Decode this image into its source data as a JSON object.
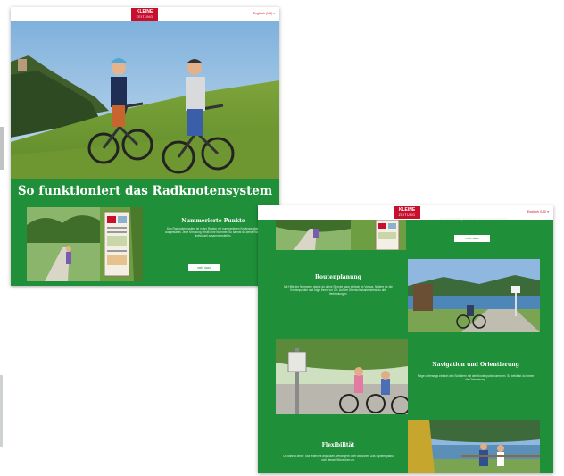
{
  "screen1": {
    "logo_line1": "KLEINE",
    "logo_line2": "ZEITUNG",
    "lang_link": "Englisch (US) ▾",
    "heading": "So funktioniert das Radknotensystem",
    "section": {
      "title": "Nummerierte Punkte",
      "text": "Das Radknotensystem ist in der Region mit nummerierten Knotenpunkten ausgestattet. Jede Kreuzung erhält eine Nummer. So kannst du deine Route individuell zusammenstellen.",
      "button": "mehr dazu"
    }
  },
  "screen2": {
    "logo_line1": "KLEINE",
    "logo_line2": "ZEITUNG",
    "lang_link": "Englisch (US) ▾",
    "top_text": "An jedem Knotenpunkt findest du eine Übersichtstafel.",
    "top_button": "mehr dazu",
    "sections": [
      {
        "title": "Routenplanung",
        "text": "Mit Hilfe der Nummern planst du deine Strecke ganz einfach im Voraus. Notiere dir die Knotenpunkte und folge ihnen vor Ort. Auf der Übersichtskarte siehst du alle Verbindungen."
      },
      {
        "title": "Navigation und Orientierung",
        "text": "Folge unterwegs einfach den Schildern mit den Knotenpunktnummern. So behältst du immer die Orientierung."
      },
      {
        "title": "Flexibilität",
        "text": "Du kannst deine Tour jederzeit anpassen, verlängern oder abkürzen. Das System passt sich deinen Wünschen an."
      }
    ]
  },
  "colors": {
    "green": "#1f8f3a",
    "red": "#c8102e"
  }
}
